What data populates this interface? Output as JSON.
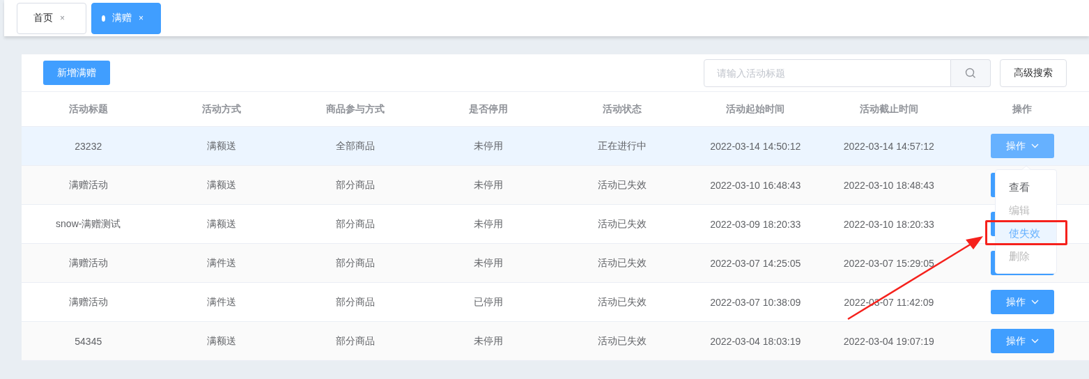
{
  "tabs": [
    {
      "label": "首页",
      "selected": false,
      "close": "×"
    },
    {
      "label": "满赠",
      "selected": true,
      "close": "×"
    }
  ],
  "toolbar": {
    "add_button": "新增满赠",
    "search": {
      "placeholder": "请输入活动标题"
    },
    "advanced_button": "高级搜索"
  },
  "table": {
    "columns": [
      "活动标题",
      "活动方式",
      "商品参与方式",
      "是否停用",
      "活动状态",
      "活动起始时间",
      "活动截止时间",
      "操作"
    ],
    "rows": [
      {
        "selected": true,
        "cells": [
          "23232",
          "满额送",
          "全部商品",
          "未停用",
          "正在进行中",
          "2022-03-14 14:50:12",
          "2022-03-14 14:57:12"
        ],
        "action": "操作"
      },
      {
        "selected": false,
        "cells": [
          "满赠活动",
          "满额送",
          "部分商品",
          "未停用",
          "活动已失效",
          "2022-03-10 16:48:43",
          "2022-03-10 18:48:43"
        ]
      },
      {
        "selected": false,
        "cells": [
          "snow-满赠测试",
          "满额送",
          "部分商品",
          "未停用",
          "活动已失效",
          "2022-03-09 18:20:33",
          "2022-03-10 18:20:33"
        ]
      },
      {
        "selected": false,
        "cells": [
          "满赠活动",
          "满件送",
          "部分商品",
          "未停用",
          "活动已失效",
          "2022-03-07 14:25:05",
          "2022-03-07 15:29:05"
        ]
      },
      {
        "selected": false,
        "cells": [
          "满赠活动",
          "满件送",
          "部分商品",
          "已停用",
          "活动已失效",
          "2022-03-07 10:38:09",
          "2022-03-07 11:42:09"
        ],
        "action": "操作"
      },
      {
        "selected": false,
        "cells": [
          "54345",
          "满额送",
          "部分商品",
          "未停用",
          "活动已失效",
          "2022-03-04 18:03:19",
          "2022-03-04 19:07:19"
        ],
        "action": "操作"
      }
    ]
  },
  "dropdown": {
    "items": [
      {
        "label": "查看",
        "disabled": false,
        "selected": false,
        "marked": false
      },
      {
        "label": "编辑",
        "disabled": true,
        "selected": false,
        "marked": false
      },
      {
        "label": "使失效",
        "disabled": false,
        "selected": true,
        "marked": true
      },
      {
        "label": "删除",
        "disabled": true,
        "selected": false,
        "marked": false
      }
    ]
  }
}
